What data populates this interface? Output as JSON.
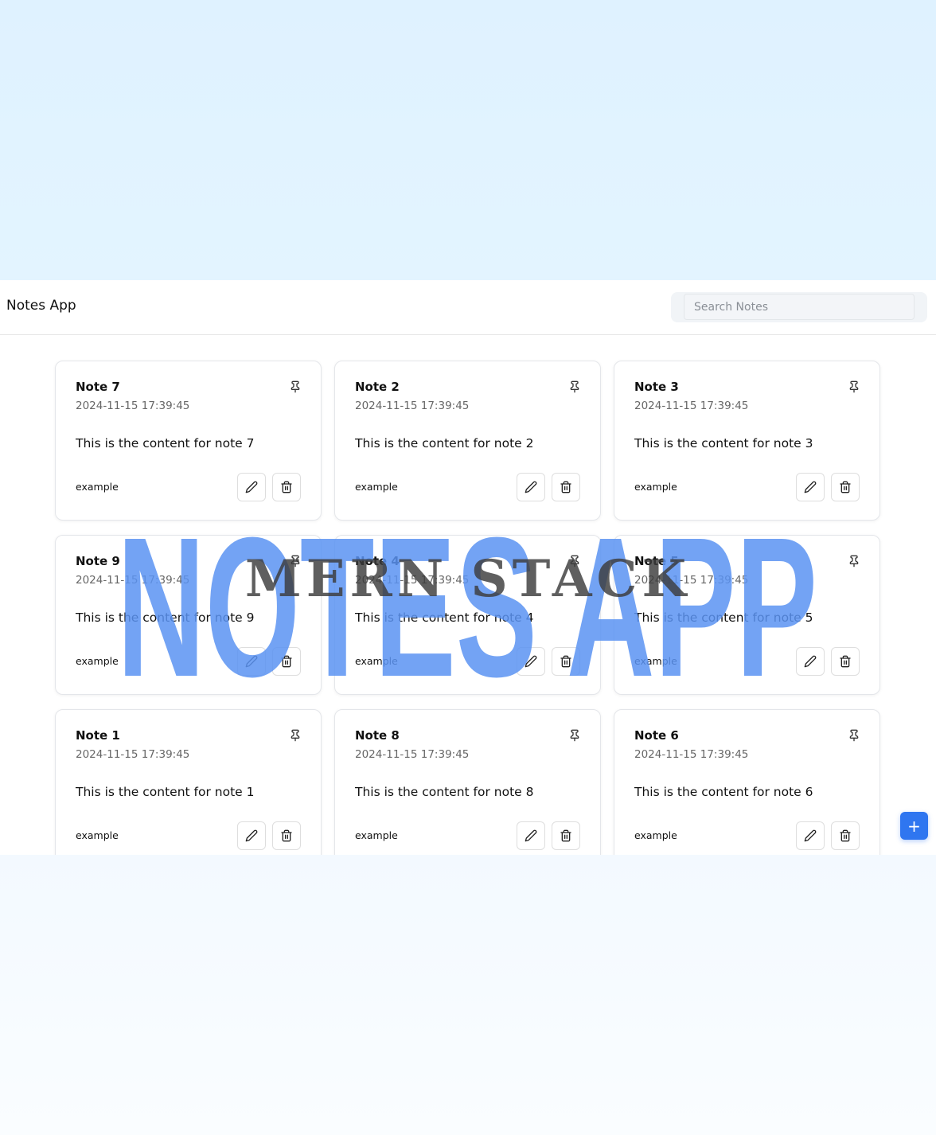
{
  "app": {
    "brand": "Notes App",
    "search_placeholder": "Search Notes"
  },
  "notes": [
    {
      "title": "Note 7",
      "date": "2024-11-15 17:39:45",
      "content": "This is the content for note 7",
      "tag": "example"
    },
    {
      "title": "Note 2",
      "date": "2024-11-15 17:39:45",
      "content": "This is the content for note 2",
      "tag": "example"
    },
    {
      "title": "Note 3",
      "date": "2024-11-15 17:39:45",
      "content": "This is the content for note 3",
      "tag": "example"
    },
    {
      "title": "Note 9",
      "date": "2024-11-15 17:39:45",
      "content": "This is the content for note 9",
      "tag": "example"
    },
    {
      "title": "Note 4",
      "date": "2024-11-15 17:39:45",
      "content": "This is the content for note 4",
      "tag": "example"
    },
    {
      "title": "Note 5",
      "date": "2024-11-15 17:39:45",
      "content": "This is the content for note 5",
      "tag": "example"
    },
    {
      "title": "Note 1",
      "date": "2024-11-15 17:39:45",
      "content": "This is the content for note 1",
      "tag": "example"
    },
    {
      "title": "Note 8",
      "date": "2024-11-15 17:39:45",
      "content": "This is the content for note 8",
      "tag": "example"
    },
    {
      "title": "Note 6",
      "date": "2024-11-15 17:39:45",
      "content": "This is the content for note 6",
      "tag": "example"
    }
  ],
  "card_icons": {
    "pin": "pin-icon",
    "edit": "pencil-icon",
    "delete": "trash-icon"
  },
  "add_button": {
    "label": "+",
    "icon": "plus-icon"
  },
  "overlay": {
    "title": "NOTES APP",
    "subtitle": "MERN STACK",
    "title_color": "#5b93f2",
    "subtitle_color": "#3c3c3c"
  },
  "colors": {
    "accent": "#2f76f0",
    "top_background": "#dff2ff"
  }
}
